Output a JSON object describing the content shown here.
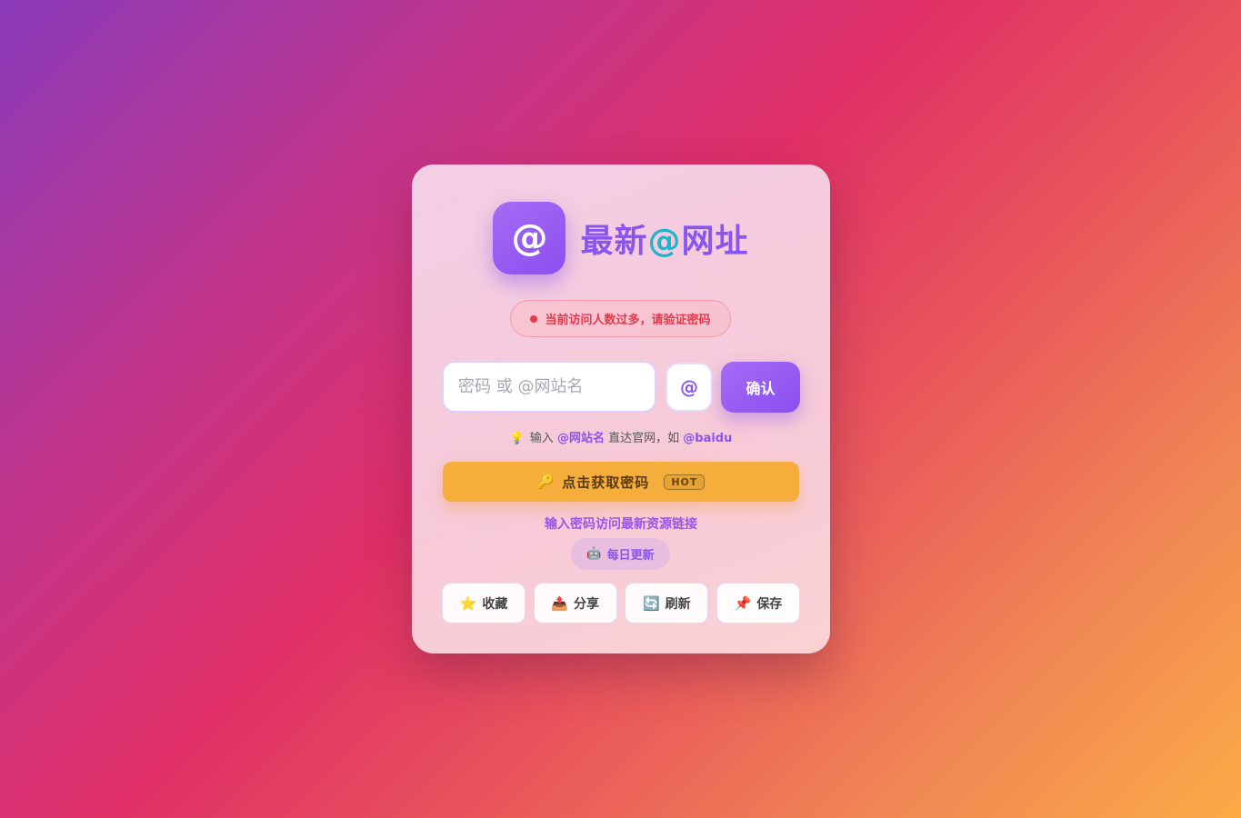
{
  "brand": {
    "logo_symbol": "@",
    "title_before": "最新",
    "title_at": "@",
    "title_after": "网址"
  },
  "alert": {
    "text": "当前访问人数过多，请验证密码"
  },
  "search": {
    "placeholder": "密码 或 @网站名",
    "value": ""
  },
  "at_button": {
    "label": "@"
  },
  "confirm_button": {
    "label": "确认"
  },
  "hint": {
    "icon": "💡",
    "prefix": "输入",
    "keyword": "@网站名",
    "middle": "直达官网，如",
    "example": "@baidu"
  },
  "get_password": {
    "icon": "🔑",
    "label": "点击获取密码",
    "badge": "HOT"
  },
  "tagline": "输入密码访问最新资源链接",
  "daily": {
    "icon": "🤖",
    "label": "每日更新"
  },
  "actions": [
    {
      "icon": "⭐",
      "label": "收藏"
    },
    {
      "icon": "📤",
      "label": "分享"
    },
    {
      "icon": "🔄",
      "label": "刷新"
    },
    {
      "icon": "📌",
      "label": "保存"
    }
  ],
  "colors": {
    "accent": "#8a55ee",
    "accent_cyan": "#22b5c9",
    "warning": "#e23a4a",
    "cta": "#f5ad3c"
  }
}
